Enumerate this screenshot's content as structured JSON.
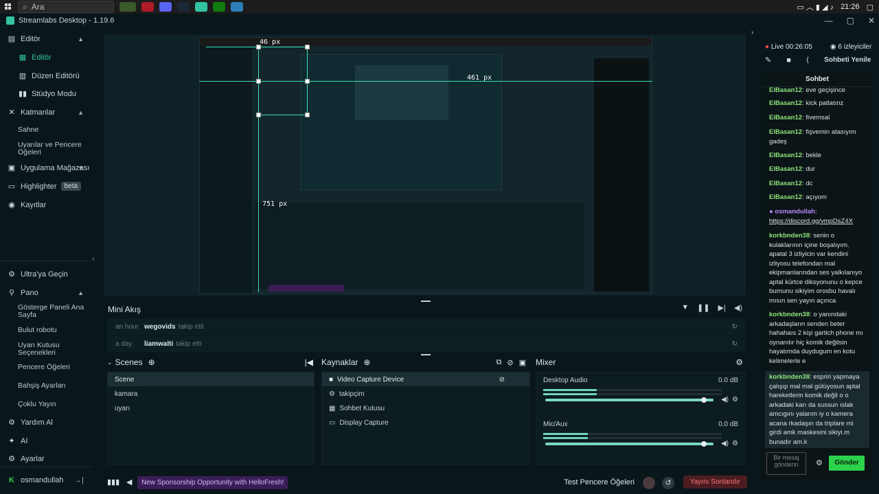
{
  "taskbar": {
    "search": "Ara",
    "time": "21:26"
  },
  "window": {
    "title": "Streamlabs Desktop - 1.19.6"
  },
  "sidebar": {
    "editor_group": "Editör",
    "editor_items": [
      "Editör",
      "Düzen Editörü",
      "Stüdyo Modu"
    ],
    "layers_group": "Katmanlar",
    "layers_items": [
      "Sahne",
      "Uyarılar ve Pencere Öğeleri"
    ],
    "store": "Uygulama Mağazası",
    "highlighter": "Highlighter",
    "beta": "beta",
    "recordings": "Kayıtlar",
    "ultra": "Ultra'ya Geçin",
    "panel_group": "Pano",
    "panel_items": [
      "Gösterge Paneli Ana Sayfa",
      "Bulut robotu",
      "Uyarı Kutusu Seçenekleri",
      "Pencere Öğeleri",
      "Bahşiş Ayarları",
      "Çoklu Yayın"
    ],
    "help": "Yardım Al",
    "ai": "AI",
    "settings": "Ayarlar",
    "user": "osmandullah"
  },
  "preview": {
    "label_top": "46 px",
    "label_right": "461 px",
    "label_left": "751 px"
  },
  "mini_feed": {
    "title": "Mini Akış",
    "rows": [
      {
        "time": "an hour",
        "user": "wegovids",
        "action": "takip etti"
      },
      {
        "time": "a day",
        "user": "liamwalti",
        "action": "takip etti"
      }
    ]
  },
  "scenes": {
    "title": "Scenes",
    "items": [
      "Scene",
      "kamara",
      "uyarı"
    ]
  },
  "sources": {
    "title": "Kaynaklar",
    "items": [
      "Video Capture Device",
      "takipçim",
      "Sohbet Kutusu",
      "Display Capture"
    ]
  },
  "mixer": {
    "title": "Mixer",
    "channels": [
      {
        "name": "Desktop Audio",
        "db": "0.0 dB",
        "level": 0.3
      },
      {
        "name": "Mic/Aux",
        "db": "0.0 dB",
        "level": 0.25
      }
    ]
  },
  "footer": {
    "promo": "New Sponsorship Opportunity with HelloFresh!",
    "test_widgets": "Test Pencere Öğeleri",
    "end_stream": "Yayını Sonlandır"
  },
  "chat": {
    "live": "Live 00:26:05",
    "viewers": "6 izleyiciler",
    "refresh": "Sohbeti Yenile",
    "title": "Sohbet",
    "messages": [
      {
        "user": "ElBasan12",
        "text": "eve geçişince"
      },
      {
        "user": "ElBasan12",
        "text": "kick patlatınz"
      },
      {
        "user": "ElBasan12",
        "text": "fivemsal"
      },
      {
        "user": "ElBasan12",
        "text": "fişvemin atasıyım gadeş"
      },
      {
        "user": "ElBasan12",
        "text": "bekle"
      },
      {
        "user": "ElBasan12",
        "text": "dur"
      },
      {
        "user": "ElBasan12",
        "text": "dc"
      },
      {
        "user": "ElBasan12",
        "text": "açıyom"
      },
      {
        "user": "osmandullah",
        "text": "https://discord.gg/vmpDsZ4X"
      },
      {
        "user": "korkbnden38",
        "text": "senin o kulaklarının içine boşalıyım. apatal 3 izliyicin var kendini izliyosu telefondan mal ekipmanlarından ses yalkılanıyo aptal kürtce diksyonunu o kepce burnunu sikiyim orosbu havalı mısın sen yayın açınca"
      },
      {
        "user": "korkbnden38",
        "text": "o yanındaki arkadaşların senden beter hahahaıs 2 kişi gartich phone mı oynanılır hiç komik değilsin hayatımda duydugum en kotu kelimelerle e"
      },
      {
        "user": "korkbnden38",
        "text": "espriri yapmaya çalışıp mal mal gülüyosun aptal hareketlerin komik değil o o arkadaki karı da sussun ıslak amcıgını yalarım iy o kamera acana rkadaşın da triplare mi girdi amk maskesini sikiyi.m bunadır am.k"
      }
    ],
    "input_placeholder": "Bir mesaj gönderin",
    "send": "Gönder"
  }
}
